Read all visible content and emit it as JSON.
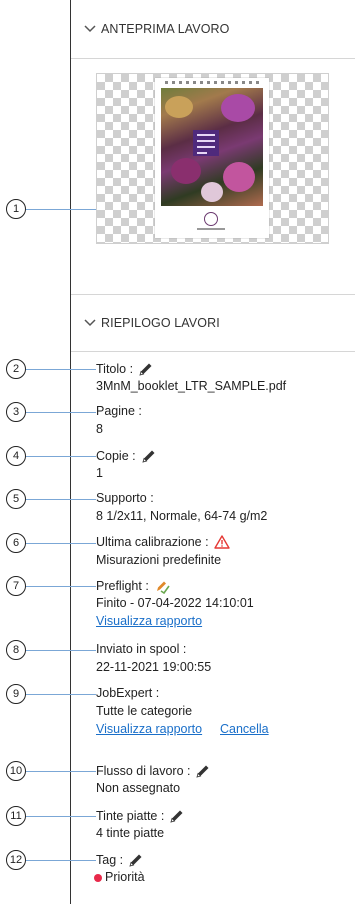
{
  "sections": {
    "preview_title": "ANTEPRIMA LAVORO",
    "summary_title": "RIEPILOGO LAVORI"
  },
  "callouts": [
    "1",
    "2",
    "3",
    "4",
    "5",
    "6",
    "7",
    "8",
    "9",
    "10",
    "11",
    "12"
  ],
  "fields": {
    "title": {
      "label": "Titolo :",
      "value": "3MnM_booklet_LTR_SAMPLE.pdf"
    },
    "pages": {
      "label": "Pagine :",
      "value": "8"
    },
    "copies": {
      "label": "Copie :",
      "value": "1"
    },
    "media": {
      "label": "Supporto :",
      "value": "8 1/2x11, Normale, 64-74 g/m2"
    },
    "calibration": {
      "label": "Ultima calibrazione :",
      "value": "Misurazioni predefinite"
    },
    "preflight": {
      "label": "Preflight :",
      "value": "Finito - 07-04-2022 14:10:01",
      "link": "Visualizza rapporto"
    },
    "spooled": {
      "label": "Inviato in spool :",
      "value": "22-11-2021 19:00:55"
    },
    "jobexpert": {
      "label": "JobExpert :",
      "value": "Tutte le categorie",
      "link": "Visualizza rapporto",
      "link2": "Cancella"
    },
    "workflow": {
      "label": "Flusso di lavoro :",
      "value": "Non assegnato"
    },
    "spot": {
      "label": "Tinte piatte :",
      "value": "4 tinte piatte"
    },
    "tag": {
      "label": "Tag :",
      "value": "Priorità",
      "color": "#e8294a"
    }
  },
  "colors": {
    "link": "#1a6fc9",
    "leader": "#7ba7d6",
    "warning": "#e53935",
    "preflight_icon": "#e0892b"
  },
  "icons": [
    "chevron-down-icon",
    "pencil-icon",
    "warning-icon",
    "preflight-check-icon"
  ]
}
